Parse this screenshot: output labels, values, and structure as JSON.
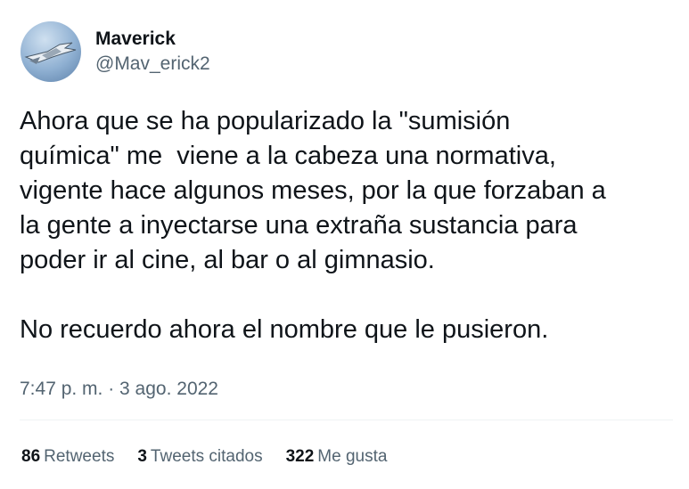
{
  "author": {
    "display_name": "Maverick",
    "handle": "@Mav_erick2",
    "avatar_icon": "fighter-jet-avatar"
  },
  "tweet": {
    "text": "Ahora que se ha popularizado la \"sumisión\nquímica\" me  viene a la cabeza una normativa,\nvigente hace algunos meses, por la que forzaban a\nla gente a inyectarse una extraña sustancia para\npoder ir al cine, al bar o al gimnasio.\n\nNo recuerdo ahora el nombre que le pusieron.",
    "timestamp": "7:47 p. m. · 3 ago. 2022"
  },
  "stats": {
    "retweets_count": "86",
    "retweets_label": "Retweets",
    "quotes_count": "3",
    "quotes_label": "Tweets citados",
    "likes_count": "322",
    "likes_label": "Me gusta"
  },
  "colors": {
    "text": "#0f1419",
    "secondary": "#536471",
    "divider": "#eff3f4"
  }
}
